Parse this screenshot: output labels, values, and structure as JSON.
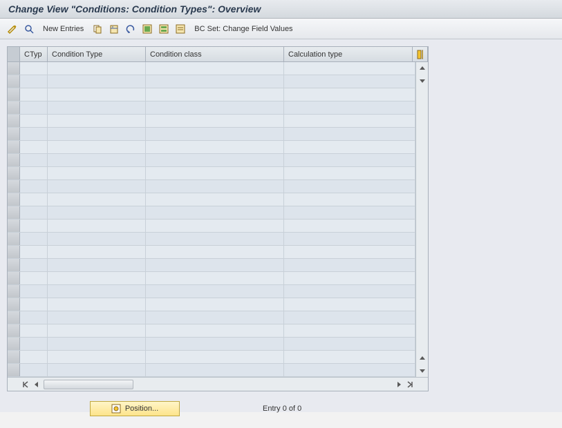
{
  "title": "Change View \"Conditions: Condition Types\": Overview",
  "toolbar": {
    "new_entries": "New Entries",
    "bc_set": "BC Set: Change Field Values"
  },
  "columns": {
    "ctyp": "CTyp",
    "condition_type": "Condition Type",
    "condition_class": "Condition class",
    "calculation_type": "Calculation type"
  },
  "rows": [],
  "empty_row_count": 24,
  "footer": {
    "position_label": "Position...",
    "entry_text": "Entry 0 of 0"
  }
}
